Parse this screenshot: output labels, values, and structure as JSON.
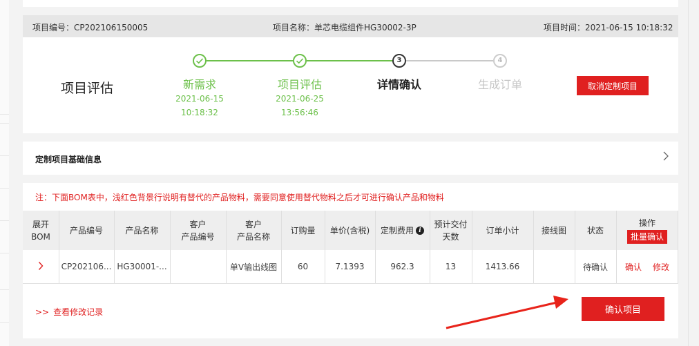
{
  "project": {
    "number_label": "项目编号：",
    "number": "CP202106150005",
    "name_label": "项目名称：",
    "name": "单芯电缆组件HG30002-3P",
    "time_label": "项目时间：",
    "time": "2021-06-15 10:18:32"
  },
  "stage_title": "项目评估",
  "steps": [
    {
      "index": "1",
      "label": "新需求",
      "date": "2021-06-15",
      "time": "10:18:32",
      "status": "done",
      "icon": "check-icon"
    },
    {
      "index": "2",
      "label": "项目评估",
      "date": "2021-06-25",
      "time": "13:56:46",
      "status": "done",
      "icon": "check-icon"
    },
    {
      "index": "3",
      "label": "详情确认",
      "date": "",
      "time": "",
      "status": "current"
    },
    {
      "index": "4",
      "label": "生成订单",
      "date": "",
      "time": "",
      "status": "todo"
    }
  ],
  "cancel_button": "取消定制项目",
  "basic_info": {
    "title": "定制项目基础信息",
    "chevron_icon": "chevron-right-icon"
  },
  "note": "注：下面BOM表中，浅红色背景行说明有替代的产品物料，需要同意使用替代物料之后才可进行确认产品和物料",
  "table": {
    "headers": {
      "expand_line1": "展开",
      "expand_line2": "BOM",
      "product_no": "产品编号",
      "product_name": "产品名称",
      "cust_no_line1": "客户",
      "cust_no_line2": "产品编号",
      "cust_name_line1": "客户",
      "cust_name_line2": "产品名称",
      "qty": "订购量",
      "unit_price": "单价(含税)",
      "custom_fee": "定制费用",
      "lead_line1": "预计交付",
      "lead_line2": "天数",
      "subtotal": "订单小计",
      "wiring": "接线图",
      "status": "状态",
      "operation": "操作",
      "batch_confirm": "批量确认"
    },
    "info_icon": "info-icon",
    "rows": [
      {
        "expand_icon": "chevron-right-icon",
        "expand_glyph": "›",
        "product_no": "CP202106...",
        "product_name": "HG30001-...",
        "cust_no": "",
        "cust_name": "单V输出线图",
        "qty": "60",
        "unit_price": "7.1393",
        "custom_fee": "962.3",
        "lead_days": "13",
        "subtotal": "1413.66",
        "wiring": "",
        "status": "待确认",
        "confirm": "确认",
        "modify": "修改"
      }
    ]
  },
  "history_prefix": ">>",
  "history_link": "查看修改记录",
  "confirm_project_button": "确认项目",
  "colors": {
    "accent_red": "#e02020",
    "done_green": "#6cc04a",
    "arrow_red": "#e8231a"
  }
}
